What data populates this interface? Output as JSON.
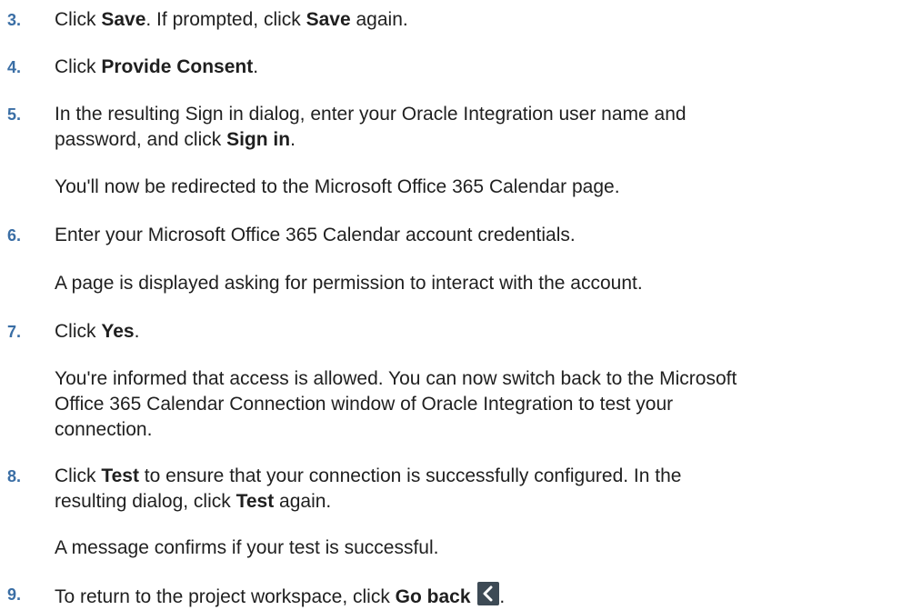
{
  "steps": [
    {
      "number": "3.",
      "parts": [
        "Click ",
        "Save",
        ". If prompted, click ",
        "Save",
        " again."
      ]
    },
    {
      "number": "4.",
      "parts": [
        "Click ",
        "Provide Consent",
        "."
      ]
    },
    {
      "number": "5.",
      "line1": "In the resulting Sign in dialog, enter your Oracle Integration user name and",
      "line2_pre": "password, and click ",
      "line2_bold": "Sign in",
      "line2_post": ".",
      "note": "You'll now be redirected to the Microsoft Office 365 Calendar page."
    },
    {
      "number": "6.",
      "text": "Enter your Microsoft Office 365 Calendar account credentials.",
      "note": "A page is displayed asking for permission to interact with the account."
    },
    {
      "number": "7.",
      "parts": [
        "Click ",
        "Yes",
        "."
      ],
      "note_lines": [
        "You're informed that access is allowed. You can now switch back to the Microsoft",
        "Office 365 Calendar Connection window of Oracle Integration to test your",
        "connection."
      ]
    },
    {
      "number": "8.",
      "line1_pre": "Click ",
      "line1_bold": "Test",
      "line1_post": " to ensure that your connection is successfully configured. In the",
      "line2_pre": "resulting dialog, click ",
      "line2_bold": "Test",
      "line2_post": " again.",
      "note": "A message confirms if your test is successful."
    },
    {
      "number": "9.",
      "pre": "To return to the project workspace, click ",
      "bold": "Go back",
      "post": ".",
      "icon": "chevron-left-icon"
    }
  ]
}
